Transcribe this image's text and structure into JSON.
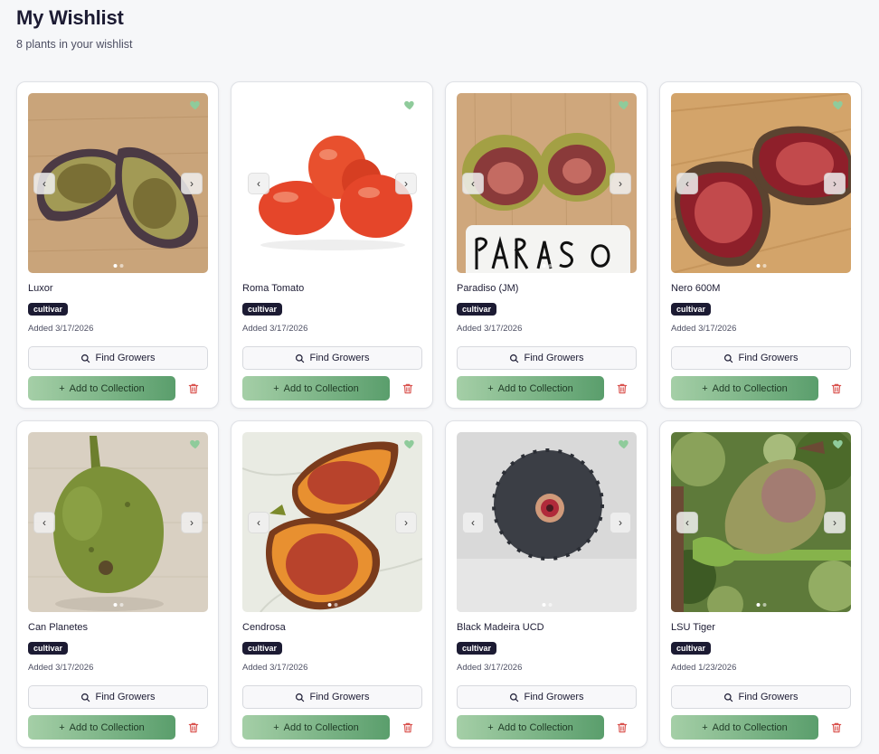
{
  "header": {
    "title": "My Wishlist",
    "subtitle": "8 plants in your wishlist"
  },
  "labels": {
    "find_growers": "Find Growers",
    "add_to_collection": "Add to Collection",
    "prev_glyph": "‹",
    "next_glyph": "›",
    "plus_glyph": "+"
  },
  "colors": {
    "heart": "#8fcb9b",
    "add_button_start": "#a5cfa7",
    "add_button_end": "#5a9e6c",
    "badge": "#1c1b33",
    "trash": "#d9534f"
  },
  "plants": [
    {
      "name": "Luxor",
      "badge": "cultivar",
      "added": "Added 3/17/2026",
      "image": "fig-green-halves-on-wood"
    },
    {
      "name": "Roma Tomato",
      "badge": "cultivar",
      "added": "Added 3/17/2026",
      "image": "roma-tomatoes-on-white"
    },
    {
      "name": "Paradiso (JM)",
      "badge": "cultivar",
      "added": "Added 3/17/2026",
      "image": "fig-halves-with-label"
    },
    {
      "name": "Nero 600M",
      "badge": "cultivar",
      "added": "Added 3/17/2026",
      "image": "fig-red-halves-on-wood"
    },
    {
      "name": "Can Planetes",
      "badge": "cultivar",
      "added": "Added 3/17/2026",
      "image": "whole-green-fig"
    },
    {
      "name": "Cendrosa",
      "badge": "cultivar",
      "added": "Added 3/17/2026",
      "image": "fig-halves-on-marble"
    },
    {
      "name": "Black Madeira UCD",
      "badge": "cultivar",
      "added": "Added 3/17/2026",
      "image": "dark-fig-top-view"
    },
    {
      "name": "LSU Tiger",
      "badge": "cultivar",
      "added": "Added 1/23/2026",
      "image": "fig-on-tree"
    }
  ]
}
